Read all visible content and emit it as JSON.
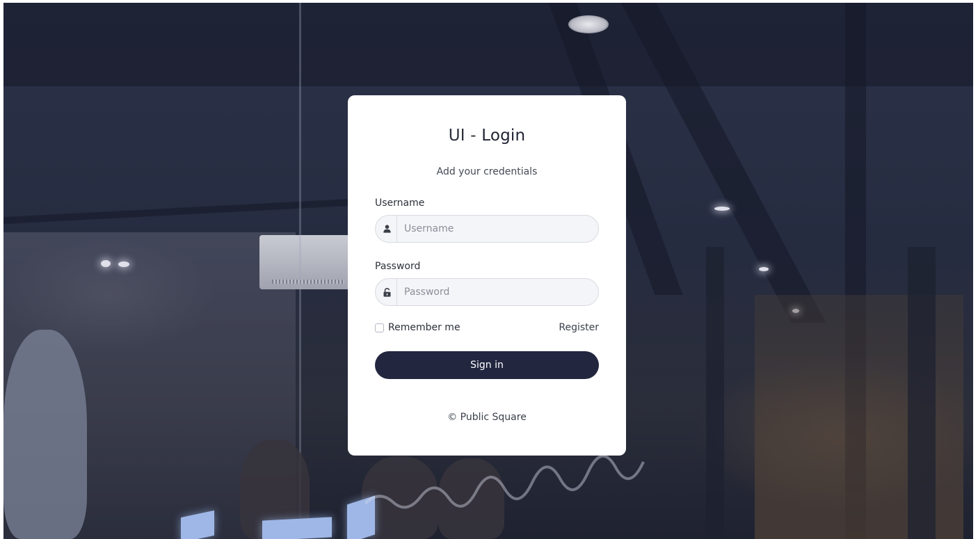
{
  "login": {
    "title_prefix": "UI - ",
    "title_main": "Login",
    "subtitle": "Add your credentials",
    "username": {
      "label": "Username",
      "placeholder": "Username",
      "value": ""
    },
    "password": {
      "label": "Password",
      "placeholder": "Password",
      "value": ""
    },
    "remember_label": "Remember me",
    "remember_checked": false,
    "register_label": "Register",
    "signin_label": "Sign in",
    "footer": "© Public Square"
  },
  "icons": {
    "username": "user-icon",
    "password": "unlock-icon"
  },
  "colors": {
    "primary_button": "#22263f",
    "card_background": "#ffffff",
    "page_background": "#262c40"
  }
}
